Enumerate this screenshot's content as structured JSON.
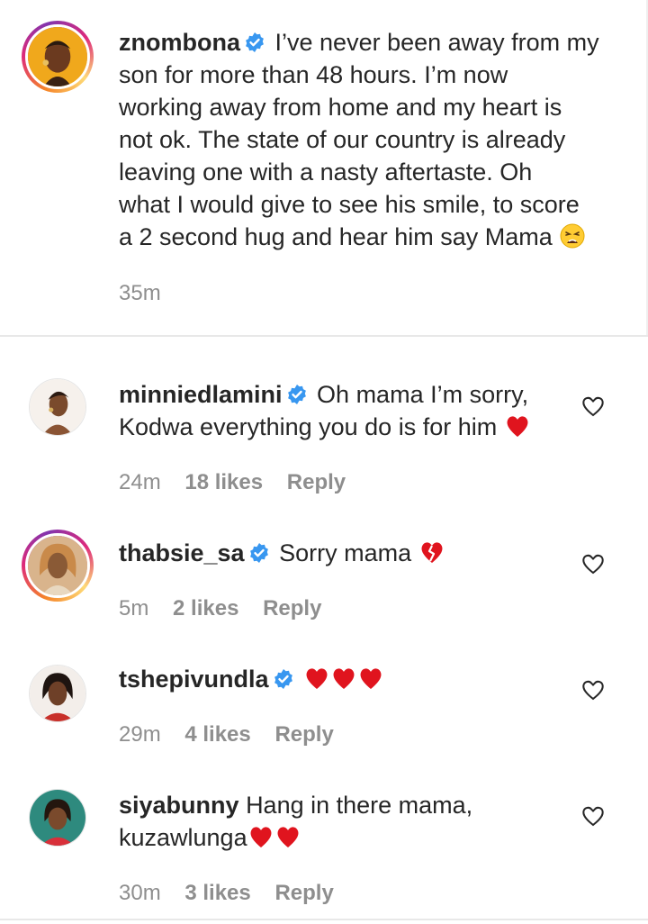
{
  "caption": {
    "username": "znombona",
    "text_lines": [
      "I’ve never been away from my",
      "son for more than 48 hours. I’m now",
      "working away from home and my heart is",
      "not ok. The state of our country is already",
      "leaving one with a nasty aftertaste. Oh",
      "what I would give to see his smile, to score",
      "a 2 second hug and hear him say Mama"
    ],
    "emoji": "weary-face",
    "time": "35m",
    "verified": true
  },
  "comments": [
    {
      "username": "minniedlamini",
      "verified": true,
      "line1": "Oh mama I’m sorry,",
      "line2": "Kodwa everything you do is for him",
      "emoji": "red-heart",
      "time": "24m",
      "likes": "18 likes",
      "reply": "Reply"
    },
    {
      "username": "thabsie_sa",
      "verified": true,
      "line1": "Sorry mama",
      "emoji": "broken-heart",
      "time": "5m",
      "likes": "2 likes",
      "reply": "Reply"
    },
    {
      "username": "tshepivundla",
      "verified": true,
      "emoji": "red-heart x3",
      "time": "29m",
      "likes": "4 likes",
      "reply": "Reply"
    },
    {
      "username": "siyabunny",
      "verified": false,
      "line1": "Hang in there mama,",
      "line2": "kuzawlunga",
      "emoji": "red-heart x2",
      "time": "30m",
      "likes": "3 likes",
      "reply": "Reply"
    }
  ],
  "colors": {
    "text": "#262626",
    "meta": "#8e8e8e",
    "verified": "#3897f0",
    "heart": "#e0141e"
  }
}
